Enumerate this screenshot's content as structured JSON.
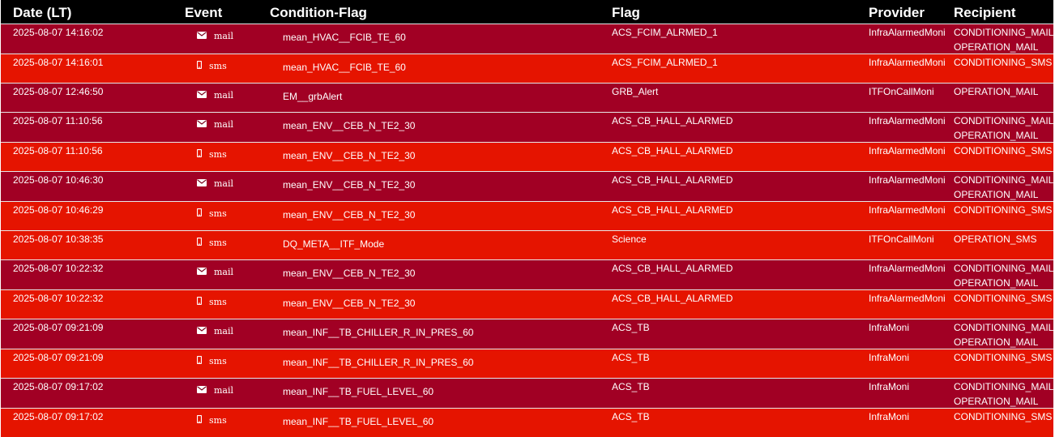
{
  "headers": {
    "date": "Date (LT)",
    "event": "Event",
    "condition": "Condition-Flag",
    "flag": "Flag",
    "provider": "Provider",
    "recipient": "Recipient"
  },
  "colors": {
    "mail_row": "#a10024",
    "sms_row": "#e51400",
    "header": "#000000"
  },
  "event_icons": {
    "mail": "envelope-icon",
    "sms": "phone-icon"
  },
  "rows": [
    {
      "date": "2025-08-07 14:16:02",
      "event": "mail",
      "condition": "mean_HVAC__FCIB_TE_60",
      "flag": "ACS_FCIM_ALRMED_1",
      "provider": "InfraAlarmedMoni",
      "recipients": [
        "CONDITIONING_MAIL",
        "OPERATION_MAIL"
      ]
    },
    {
      "date": "2025-08-07 14:16:01",
      "event": "sms",
      "condition": "mean_HVAC__FCIB_TE_60",
      "flag": "ACS_FCIM_ALRMED_1",
      "provider": "InfraAlarmedMoni",
      "recipients": [
        "CONDITIONING_SMS"
      ]
    },
    {
      "date": "2025-08-07 12:46:50",
      "event": "mail",
      "condition": "EM__grbAlert",
      "flag": "GRB_Alert",
      "provider": "ITFOnCallMoni",
      "recipients": [
        "OPERATION_MAIL"
      ]
    },
    {
      "date": "2025-08-07 11:10:56",
      "event": "mail",
      "condition": "mean_ENV__CEB_N_TE2_30",
      "flag": "ACS_CB_HALL_ALARMED",
      "provider": "InfraAlarmedMoni",
      "recipients": [
        "CONDITIONING_MAIL",
        "OPERATION_MAIL"
      ]
    },
    {
      "date": "2025-08-07 11:10:56",
      "event": "sms",
      "condition": "mean_ENV__CEB_N_TE2_30",
      "flag": "ACS_CB_HALL_ALARMED",
      "provider": "InfraAlarmedMoni",
      "recipients": [
        "CONDITIONING_SMS"
      ]
    },
    {
      "date": "2025-08-07 10:46:30",
      "event": "mail",
      "condition": "mean_ENV__CEB_N_TE2_30",
      "flag": "ACS_CB_HALL_ALARMED",
      "provider": "InfraAlarmedMoni",
      "recipients": [
        "CONDITIONING_MAIL",
        "OPERATION_MAIL"
      ]
    },
    {
      "date": "2025-08-07 10:46:29",
      "event": "sms",
      "condition": "mean_ENV__CEB_N_TE2_30",
      "flag": "ACS_CB_HALL_ALARMED",
      "provider": "InfraAlarmedMoni",
      "recipients": [
        "CONDITIONING_SMS"
      ]
    },
    {
      "date": "2025-08-07 10:38:35",
      "event": "sms",
      "condition": "DQ_META__ITF_Mode",
      "flag": "Science",
      "provider": "ITFOnCallMoni",
      "recipients": [
        "OPERATION_SMS"
      ]
    },
    {
      "date": "2025-08-07 10:22:32",
      "event": "mail",
      "condition": "mean_ENV__CEB_N_TE2_30",
      "flag": "ACS_CB_HALL_ALARMED",
      "provider": "InfraAlarmedMoni",
      "recipients": [
        "CONDITIONING_MAIL",
        "OPERATION_MAIL"
      ]
    },
    {
      "date": "2025-08-07 10:22:32",
      "event": "sms",
      "condition": "mean_ENV__CEB_N_TE2_30",
      "flag": "ACS_CB_HALL_ALARMED",
      "provider": "InfraAlarmedMoni",
      "recipients": [
        "CONDITIONING_SMS"
      ]
    },
    {
      "date": "2025-08-07 09:21:09",
      "event": "mail",
      "condition": "mean_INF__TB_CHILLER_R_IN_PRES_60",
      "flag": "ACS_TB",
      "provider": "InfraMoni",
      "recipients": [
        "CONDITIONING_MAIL",
        "OPERATION_MAIL"
      ]
    },
    {
      "date": "2025-08-07 09:21:09",
      "event": "sms",
      "condition": "mean_INF__TB_CHILLER_R_IN_PRES_60",
      "flag": "ACS_TB",
      "provider": "InfraMoni",
      "recipients": [
        "CONDITIONING_SMS"
      ]
    },
    {
      "date": "2025-08-07 09:17:02",
      "event": "mail",
      "condition": "mean_INF__TB_FUEL_LEVEL_60",
      "flag": "ACS_TB",
      "provider": "InfraMoni",
      "recipients": [
        "CONDITIONING_MAIL",
        "OPERATION_MAIL"
      ]
    },
    {
      "date": "2025-08-07 09:17:02",
      "event": "sms",
      "condition": "mean_INF__TB_FUEL_LEVEL_60",
      "flag": "ACS_TB",
      "provider": "InfraMoni",
      "recipients": [
        "CONDITIONING_SMS"
      ]
    }
  ]
}
